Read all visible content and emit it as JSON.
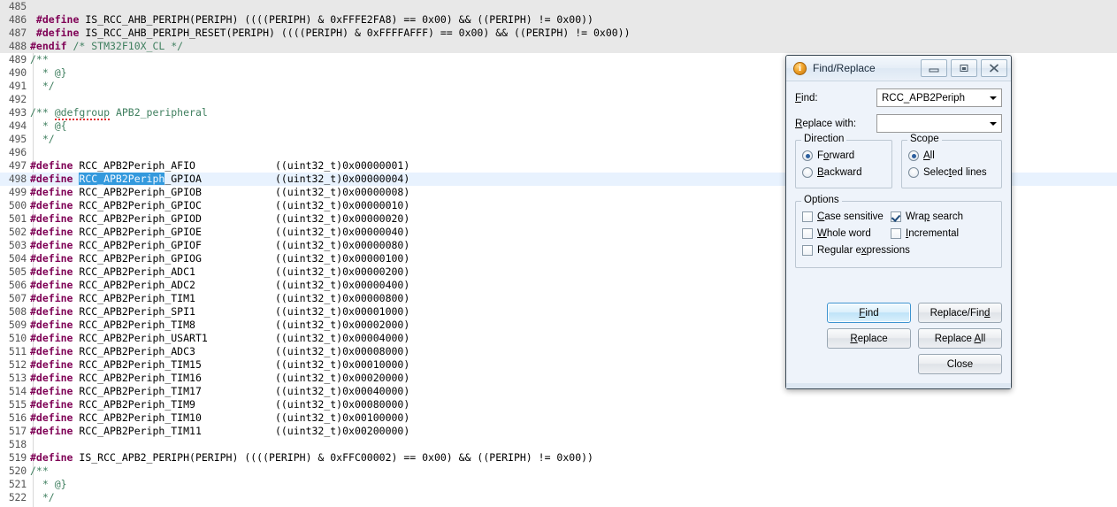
{
  "editor": {
    "name": "source-code-editor",
    "first_line_number": 485,
    "lines": [
      {
        "n": 485,
        "bg": "inactive",
        "tokens": []
      },
      {
        "n": 486,
        "bg": "inactive",
        "tokens": [
          {
            "c": "pre",
            "t": " #define "
          },
          {
            "c": "plain",
            "t": "IS_RCC_AHB_PERIPH(PERIPH) ((((PERIPH) & 0xFFFE2FA8) == 0x00) && ((PERIPH) != 0x00))"
          }
        ]
      },
      {
        "n": 487,
        "bg": "inactive",
        "tokens": [
          {
            "c": "pre",
            "t": " #define "
          },
          {
            "c": "plain",
            "t": "IS_RCC_AHB_PERIPH_RESET(PERIPH) ((((PERIPH) & 0xFFFFAFFF) == 0x00) && ((PERIPH) != 0x00))"
          }
        ]
      },
      {
        "n": 488,
        "bg": "inactive",
        "tokens": [
          {
            "c": "pre",
            "t": "#endif "
          },
          {
            "c": "comment",
            "t": "/* STM32F10X_CL */"
          }
        ]
      },
      {
        "n": 489,
        "bg": "",
        "tokens": [
          {
            "c": "comment",
            "t": "/**"
          }
        ]
      },
      {
        "n": 490,
        "bg": "",
        "tokens": [
          {
            "c": "comment",
            "t": "  * @}"
          }
        ]
      },
      {
        "n": 491,
        "bg": "",
        "tokens": [
          {
            "c": "comment",
            "t": "  */"
          }
        ]
      },
      {
        "n": 492,
        "bg": "",
        "tokens": []
      },
      {
        "n": 493,
        "bg": "",
        "tokens": [
          {
            "c": "comment",
            "t": "/** "
          },
          {
            "c": "comment spell",
            "t": "@defgroup"
          },
          {
            "c": "comment",
            "t": " APB2_peripheral"
          }
        ]
      },
      {
        "n": 494,
        "bg": "",
        "tokens": [
          {
            "c": "comment",
            "t": "  * @{"
          }
        ]
      },
      {
        "n": 495,
        "bg": "",
        "tokens": [
          {
            "c": "comment",
            "t": "  */"
          }
        ]
      },
      {
        "n": 496,
        "bg": "",
        "tokens": []
      },
      {
        "n": 497,
        "bg": "",
        "tokens": [
          {
            "c": "pre",
            "t": "#define "
          },
          {
            "c": "plain",
            "t": "RCC_APB2Periph_AFIO             ((uint32_t)0x00000001)"
          }
        ]
      },
      {
        "n": 498,
        "bg": "current",
        "tokens": [
          {
            "c": "pre",
            "t": "#define "
          },
          {
            "c": "sel",
            "t": "RCC_APB2Periph"
          },
          {
            "c": "plain",
            "t": "_GPIOA            ((uint32_t)0x00000004)"
          }
        ]
      },
      {
        "n": 499,
        "bg": "",
        "tokens": [
          {
            "c": "pre",
            "t": "#define "
          },
          {
            "c": "plain",
            "t": "RCC_APB2Periph_GPIOB            ((uint32_t)0x00000008)"
          }
        ]
      },
      {
        "n": 500,
        "bg": "",
        "tokens": [
          {
            "c": "pre",
            "t": "#define "
          },
          {
            "c": "plain",
            "t": "RCC_APB2Periph_GPIOC            ((uint32_t)0x00000010)"
          }
        ]
      },
      {
        "n": 501,
        "bg": "",
        "tokens": [
          {
            "c": "pre",
            "t": "#define "
          },
          {
            "c": "plain",
            "t": "RCC_APB2Periph_GPIOD            ((uint32_t)0x00000020)"
          }
        ]
      },
      {
        "n": 502,
        "bg": "",
        "tokens": [
          {
            "c": "pre",
            "t": "#define "
          },
          {
            "c": "plain",
            "t": "RCC_APB2Periph_GPIOE            ((uint32_t)0x00000040)"
          }
        ]
      },
      {
        "n": 503,
        "bg": "",
        "tokens": [
          {
            "c": "pre",
            "t": "#define "
          },
          {
            "c": "plain",
            "t": "RCC_APB2Periph_GPIOF            ((uint32_t)0x00000080)"
          }
        ]
      },
      {
        "n": 504,
        "bg": "",
        "tokens": [
          {
            "c": "pre",
            "t": "#define "
          },
          {
            "c": "plain",
            "t": "RCC_APB2Periph_GPIOG            ((uint32_t)0x00000100)"
          }
        ]
      },
      {
        "n": 505,
        "bg": "",
        "tokens": [
          {
            "c": "pre",
            "t": "#define "
          },
          {
            "c": "plain",
            "t": "RCC_APB2Periph_ADC1             ((uint32_t)0x00000200)"
          }
        ]
      },
      {
        "n": 506,
        "bg": "",
        "tokens": [
          {
            "c": "pre",
            "t": "#define "
          },
          {
            "c": "plain",
            "t": "RCC_APB2Periph_ADC2             ((uint32_t)0x00000400)"
          }
        ]
      },
      {
        "n": 507,
        "bg": "",
        "tokens": [
          {
            "c": "pre",
            "t": "#define "
          },
          {
            "c": "plain",
            "t": "RCC_APB2Periph_TIM1             ((uint32_t)0x00000800)"
          }
        ]
      },
      {
        "n": 508,
        "bg": "",
        "tokens": [
          {
            "c": "pre",
            "t": "#define "
          },
          {
            "c": "plain",
            "t": "RCC_APB2Periph_SPI1             ((uint32_t)0x00001000)"
          }
        ]
      },
      {
        "n": 509,
        "bg": "",
        "tokens": [
          {
            "c": "pre",
            "t": "#define "
          },
          {
            "c": "plain",
            "t": "RCC_APB2Periph_TIM8             ((uint32_t)0x00002000)"
          }
        ]
      },
      {
        "n": 510,
        "bg": "",
        "tokens": [
          {
            "c": "pre",
            "t": "#define "
          },
          {
            "c": "plain",
            "t": "RCC_APB2Periph_USART1           ((uint32_t)0x00004000)"
          }
        ]
      },
      {
        "n": 511,
        "bg": "",
        "tokens": [
          {
            "c": "pre",
            "t": "#define "
          },
          {
            "c": "plain",
            "t": "RCC_APB2Periph_ADC3             ((uint32_t)0x00008000)"
          }
        ]
      },
      {
        "n": 512,
        "bg": "",
        "tokens": [
          {
            "c": "pre",
            "t": "#define "
          },
          {
            "c": "plain",
            "t": "RCC_APB2Periph_TIM15            ((uint32_t)0x00010000)"
          }
        ]
      },
      {
        "n": 513,
        "bg": "",
        "tokens": [
          {
            "c": "pre",
            "t": "#define "
          },
          {
            "c": "plain",
            "t": "RCC_APB2Periph_TIM16            ((uint32_t)0x00020000)"
          }
        ]
      },
      {
        "n": 514,
        "bg": "",
        "tokens": [
          {
            "c": "pre",
            "t": "#define "
          },
          {
            "c": "plain",
            "t": "RCC_APB2Periph_TIM17            ((uint32_t)0x00040000)"
          }
        ]
      },
      {
        "n": 515,
        "bg": "",
        "tokens": [
          {
            "c": "pre",
            "t": "#define "
          },
          {
            "c": "plain",
            "t": "RCC_APB2Periph_TIM9             ((uint32_t)0x00080000)"
          }
        ]
      },
      {
        "n": 516,
        "bg": "",
        "tokens": [
          {
            "c": "pre",
            "t": "#define "
          },
          {
            "c": "plain",
            "t": "RCC_APB2Periph_TIM10            ((uint32_t)0x00100000)"
          }
        ]
      },
      {
        "n": 517,
        "bg": "",
        "tokens": [
          {
            "c": "pre",
            "t": "#define "
          },
          {
            "c": "plain",
            "t": "RCC_APB2Periph_TIM11            ((uint32_t)0x00200000)"
          }
        ]
      },
      {
        "n": 518,
        "bg": "",
        "tokens": []
      },
      {
        "n": 519,
        "bg": "",
        "tokens": [
          {
            "c": "pre",
            "t": "#define "
          },
          {
            "c": "plain",
            "t": "IS_RCC_APB2_PERIPH(PERIPH) ((((PERIPH) & 0xFFC00002) == 0x00) && ((PERIPH) != 0x00))"
          }
        ]
      },
      {
        "n": 520,
        "bg": "",
        "tokens": [
          {
            "c": "comment",
            "t": "/**"
          }
        ]
      },
      {
        "n": 521,
        "bg": "",
        "tokens": [
          {
            "c": "comment",
            "t": "  * @}"
          }
        ]
      },
      {
        "n": 522,
        "bg": "",
        "tokens": [
          {
            "c": "comment",
            "t": "  */"
          }
        ]
      }
    ]
  },
  "dialog": {
    "title": "Find/Replace",
    "icon": "info-circle-icon",
    "window_buttons": [
      {
        "name": "minimize-button",
        "glyph": "minimize-icon"
      },
      {
        "name": "maximize-button",
        "glyph": "maximize-icon"
      },
      {
        "name": "close-button",
        "glyph": "close-icon"
      }
    ],
    "fields": {
      "find_label": "Find:",
      "find_value": "RCC_APB2Periph",
      "replace_label": "Replace with:",
      "replace_value": ""
    },
    "direction": {
      "title": "Direction",
      "options": [
        {
          "label": "Forward",
          "selected": true
        },
        {
          "label": "Backward",
          "selected": false
        }
      ]
    },
    "scope": {
      "title": "Scope",
      "options": [
        {
          "label": "All",
          "selected": true
        },
        {
          "label": "Selected lines",
          "selected": false
        }
      ]
    },
    "options": {
      "title": "Options",
      "items": [
        {
          "label": "Case sensitive",
          "checked": false
        },
        {
          "label": "Wrap search",
          "checked": true
        },
        {
          "label": "Whole word",
          "checked": false
        },
        {
          "label": "Incremental",
          "checked": false
        },
        {
          "label": "Regular expressions",
          "checked": false
        }
      ]
    },
    "buttons": {
      "find": "Find",
      "replace_find": "Replace/Find",
      "replace": "Replace",
      "replace_all": "Replace All",
      "close": "Close"
    },
    "colors": {
      "default_button_border": "#3c93d0",
      "selection_blue": "#3399dd",
      "dialog_bg": "#eef3fa"
    }
  }
}
